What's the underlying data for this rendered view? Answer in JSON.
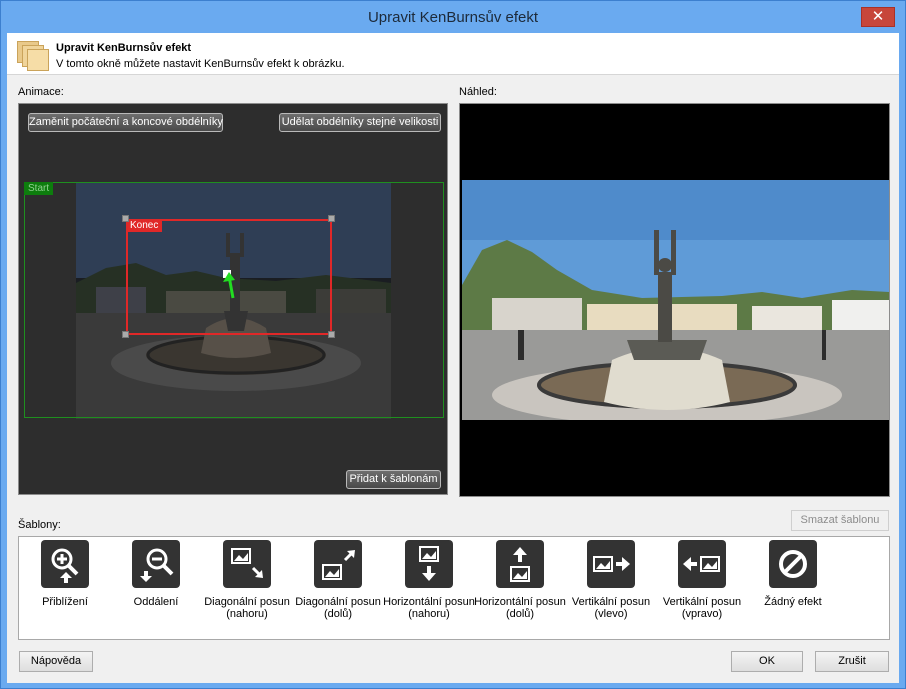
{
  "window": {
    "title": "Upravit KenBurnsův efekt",
    "close_label": "✕"
  },
  "header": {
    "title": "Upravit KenBurnsův efekt",
    "description": "V tomto okně můžete nastavit KenBurnsův efekt k obrázku."
  },
  "animation": {
    "label": "Animace:",
    "swap_button": "Zaměnit počáteční a koncové obdélníky",
    "same_size_button": "Udělat obdélníky stejné velikosti",
    "start_label": "Start",
    "end_label": "Konec",
    "add_to_templates_button": "Přidat k šablonám"
  },
  "preview": {
    "label": "Náhled:"
  },
  "templates": {
    "label": "Šablony:",
    "delete_button": "Smazat šablonu",
    "items": [
      {
        "label": "Přiblížení",
        "icon": "zoom-in-icon"
      },
      {
        "label": "Oddálení",
        "icon": "zoom-out-icon"
      },
      {
        "label": "Diagonální posun (nahoru)",
        "icon": "diagonal-up-icon"
      },
      {
        "label": "Diagonální posun (dolů)",
        "icon": "diagonal-down-icon"
      },
      {
        "label": "Horizontální posun (nahoru)",
        "icon": "pan-up-icon"
      },
      {
        "label": "Horizontální posun (dolů)",
        "icon": "pan-down-icon"
      },
      {
        "label": "Vertikální posun (vlevo)",
        "icon": "pan-left-icon"
      },
      {
        "label": "Vertikální posun (vpravo)",
        "icon": "pan-right-icon"
      },
      {
        "label": "Žádný efekt",
        "icon": "no-effect-icon"
      }
    ]
  },
  "footer": {
    "help_button": "Nápověda",
    "ok_button": "OK",
    "cancel_button": "Zrušit"
  },
  "colors": {
    "titlebar": "#6aaaf0",
    "start_rect": "#0d7d0d",
    "end_rect": "#e02828",
    "template_icon_bg": "#333333"
  }
}
